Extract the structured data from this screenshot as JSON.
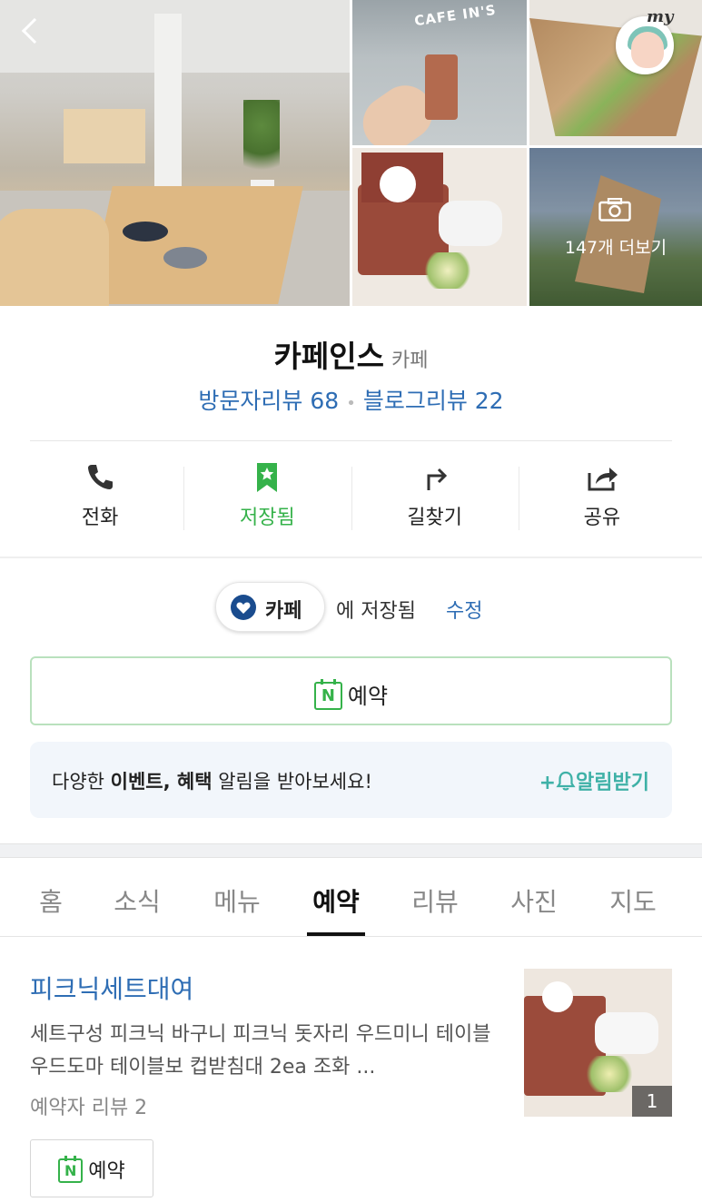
{
  "gallery": {
    "more_photos_label": "147개 더보기",
    "storefront_sign": "CAFE IN'S",
    "my_badge": "my"
  },
  "place": {
    "name": "카페인스",
    "category": "카페",
    "visitor_reviews": "방문자리뷰 68",
    "blog_reviews": "블로그리뷰 22"
  },
  "actions": [
    {
      "label": "전화",
      "icon": "phone-icon"
    },
    {
      "label": "저장됨",
      "icon": "bookmark-star-icon"
    },
    {
      "label": "길찾기",
      "icon": "directions-icon"
    },
    {
      "label": "공유",
      "icon": "share-icon"
    }
  ],
  "saved": {
    "folder": "카페",
    "suffix": "에 저장됨",
    "edit": "수정"
  },
  "reserve_button": {
    "label": "예약",
    "badge": "N"
  },
  "notice": {
    "prefix": "다양한 ",
    "bold": "이벤트, 혜택",
    "suffix": " 알림을 받아보세요!",
    "subscribe": "+알림받기"
  },
  "tabs": [
    "홈",
    "소식",
    "메뉴",
    "예약",
    "리뷰",
    "사진",
    "지도"
  ],
  "active_tab": "예약",
  "booking_item": {
    "title": "피크닉세트대여",
    "description": "세트구성 피크닉 바구니 피크닉 돗자리 우드미니 테이블 우드도마 테이블보 컵받침대 2ea 조화 ...",
    "reviews": "예약자 리뷰 2",
    "photo_count": "1",
    "reserve_label": "예약"
  },
  "colors": {
    "link_blue": "#2e6db4",
    "naver_green": "#35b24a",
    "notice_teal": "#3fb1a7",
    "heart_navy": "#1a4c8e"
  }
}
